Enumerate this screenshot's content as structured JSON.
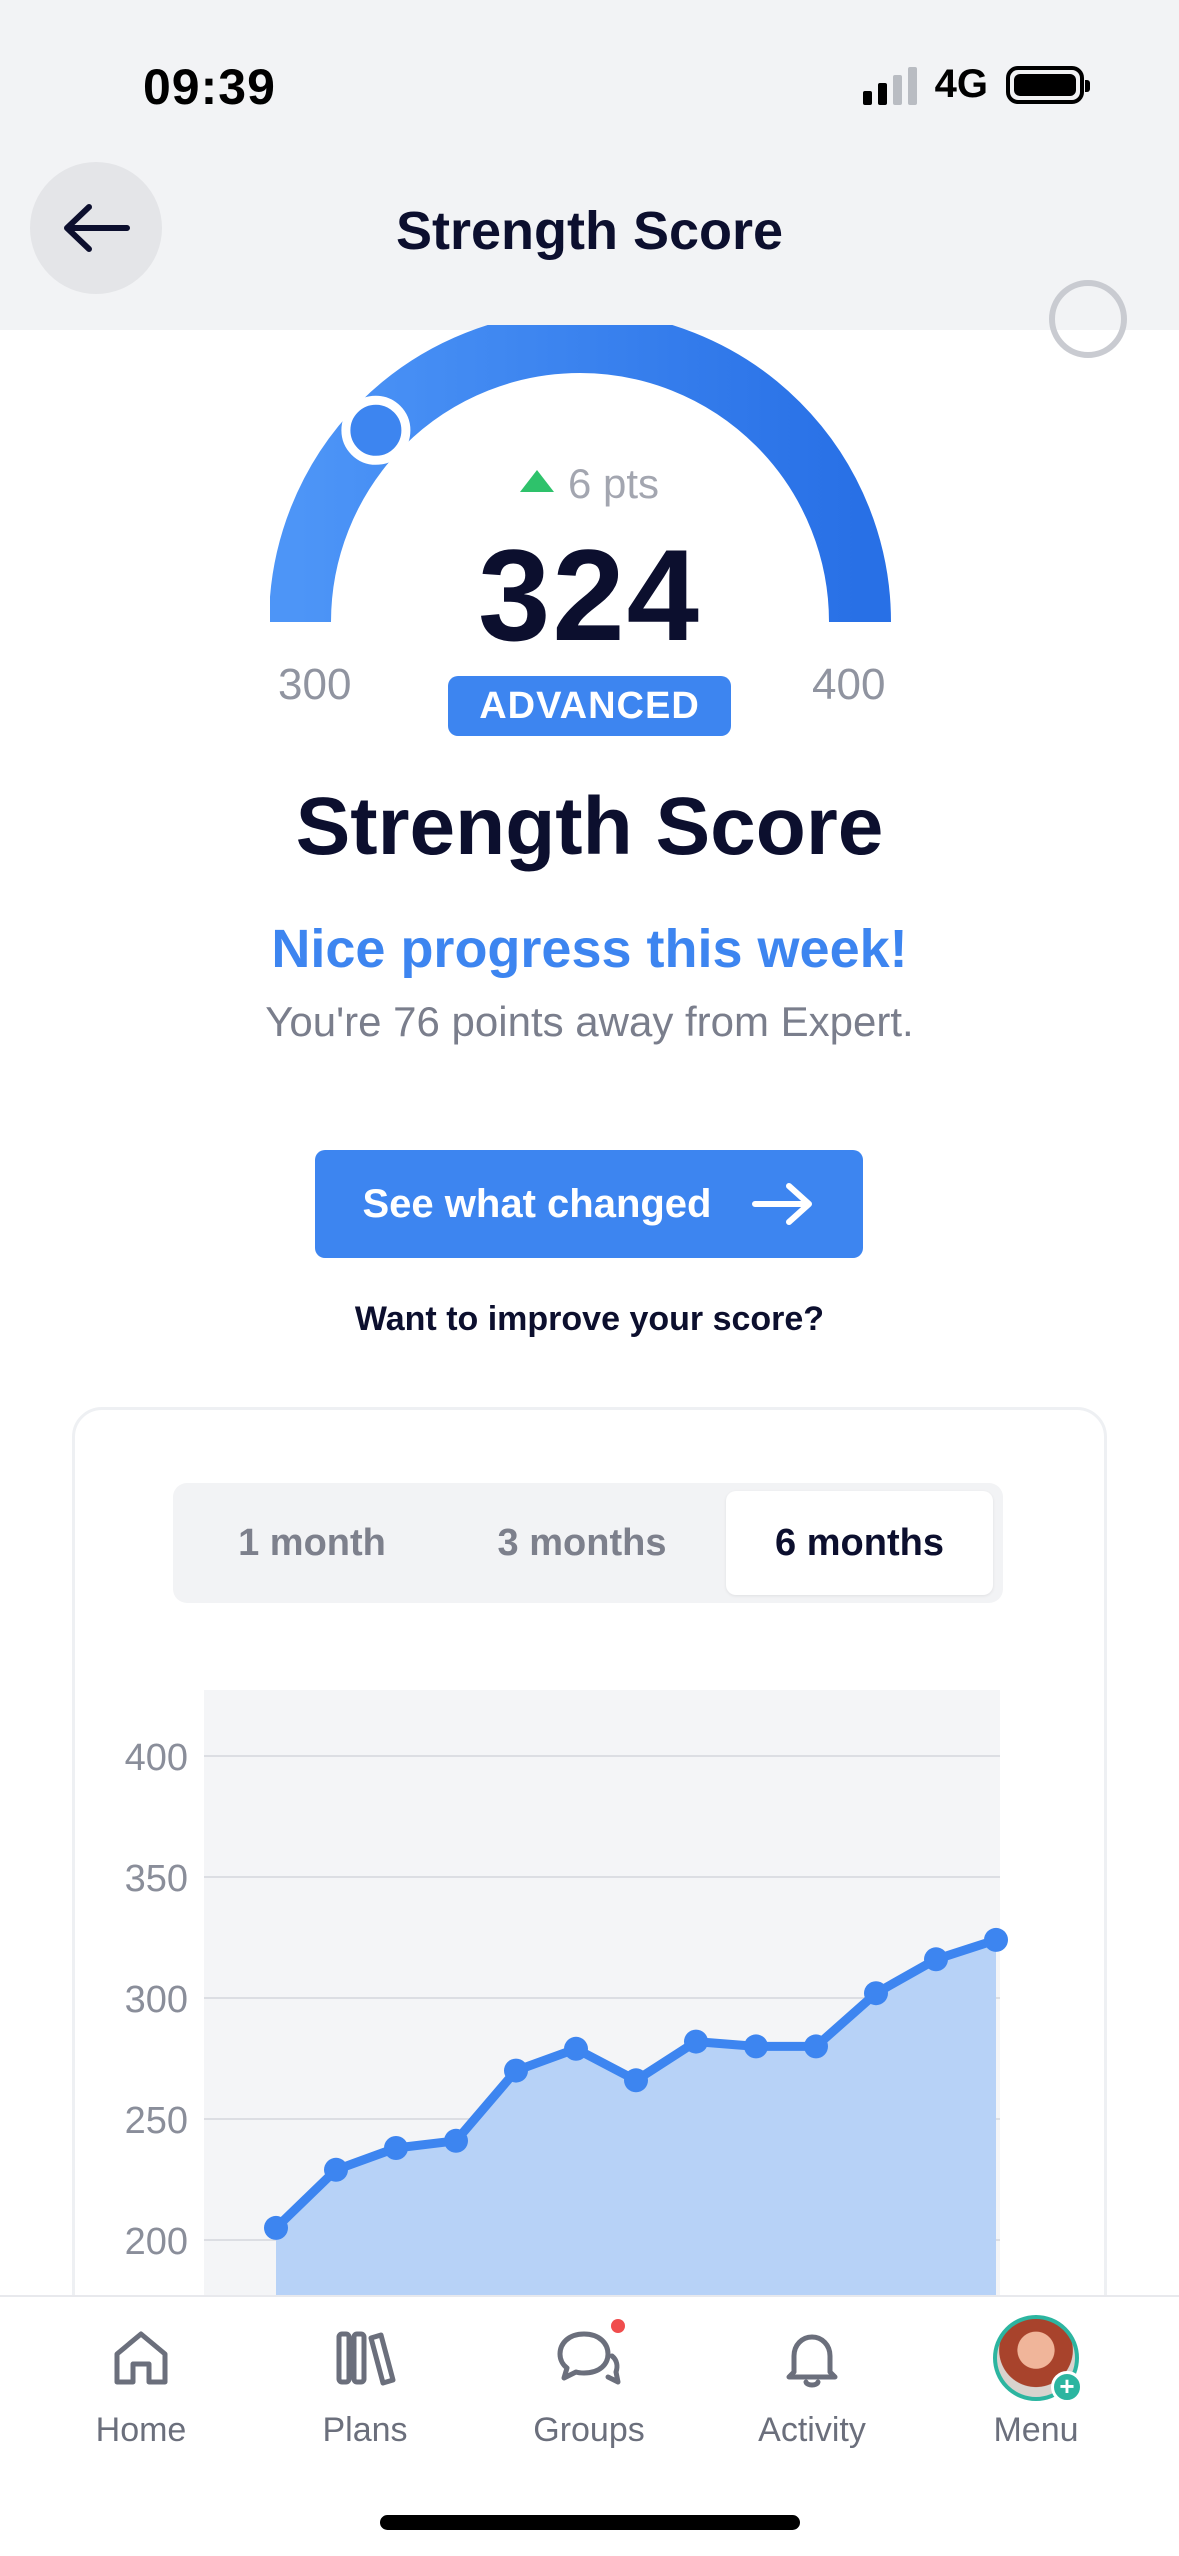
{
  "status_bar": {
    "time": "09:39",
    "network": "4G"
  },
  "header": {
    "title": "Strength Score"
  },
  "gauge": {
    "change": "6 pts",
    "score": "324",
    "level": "ADVANCED",
    "min_label": "300",
    "max_label": "400",
    "min": 300,
    "max": 400,
    "value": 324
  },
  "summary": {
    "title": "Strength Score",
    "headline": "Nice progress this week!",
    "detail": "You're 76 points away from Expert."
  },
  "cta": {
    "label": "See what changed"
  },
  "improve_link": "Want to improve your score?",
  "range_tabs": [
    {
      "label": "1 month"
    },
    {
      "label": "3 months"
    },
    {
      "label": "6 months",
      "active": true
    }
  ],
  "chart_data": {
    "type": "area",
    "title": "",
    "xlabel": "",
    "ylabel": "",
    "ylim": [
      200,
      400
    ],
    "yticks": [
      "400",
      "350",
      "300",
      "250",
      "200"
    ],
    "values": [
      205,
      229,
      238,
      241,
      270,
      279,
      266,
      282,
      280,
      280,
      302,
      316,
      324
    ],
    "grid": true,
    "colors": {
      "line": "#3d85f0",
      "fill": "#b7d2f7",
      "plot_bg": "#f4f5f7"
    }
  },
  "bottom_nav": {
    "items": [
      {
        "label": "Home",
        "icon": "home-icon"
      },
      {
        "label": "Plans",
        "icon": "plans-icon"
      },
      {
        "label": "Groups",
        "icon": "groups-icon"
      },
      {
        "label": "Activity",
        "icon": "bell-icon"
      },
      {
        "label": "Menu",
        "icon": "avatar"
      }
    ]
  },
  "colors": {
    "accent": "#3d85f0",
    "up": "#2ec26b",
    "text_dark": "#0c0f2e"
  }
}
